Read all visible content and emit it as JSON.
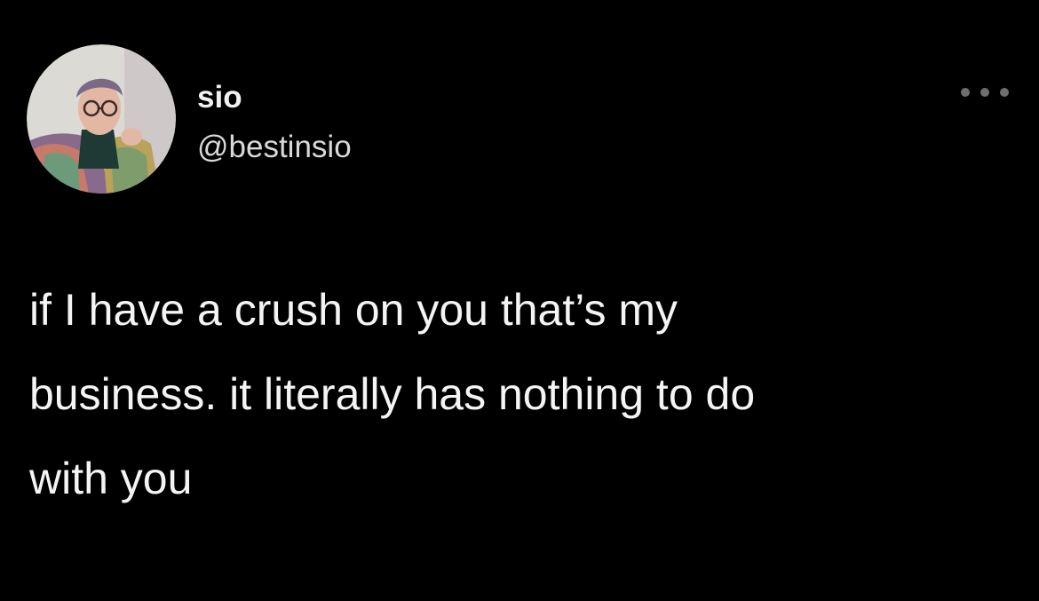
{
  "tweet": {
    "author": {
      "display_name": "sio",
      "handle": "@bestinsio"
    },
    "text": "if I have a crush on you that’s my\nbusiness. it literally has nothing to do\nwith you",
    "more_icon": "more-horizontal-icon"
  },
  "colors": {
    "background": "#000000",
    "text": "#f4f4f4",
    "more_icon": "#6f6f6f"
  }
}
